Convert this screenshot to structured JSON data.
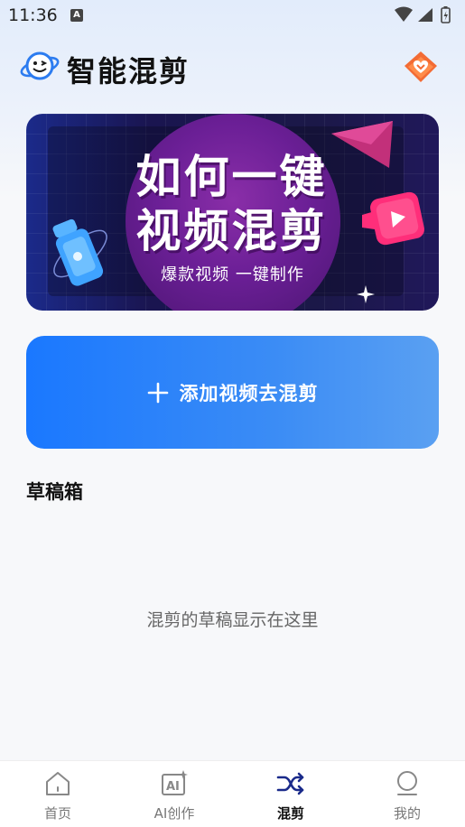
{
  "status_bar": {
    "time": "11:36",
    "notification_icon": "A"
  },
  "header": {
    "title": "智能混剪",
    "logo_icon": "planet-face-icon",
    "vip_icon": "vip-heart-badge-icon"
  },
  "banner": {
    "line1": "如何一键",
    "line2": "视频混剪",
    "subtitle": "爆款视频 一键制作"
  },
  "add_button": {
    "label": "添加视频去混剪",
    "icon": "plus-icon"
  },
  "drafts": {
    "title": "草稿箱",
    "empty_text": "混剪的草稿显示在这里"
  },
  "bottom_nav": {
    "items": [
      {
        "label": "首页",
        "icon": "home-icon",
        "active": false
      },
      {
        "label": "AI创作",
        "icon": "ai-create-icon",
        "active": false
      },
      {
        "label": "混剪",
        "icon": "shuffle-icon",
        "active": true
      },
      {
        "label": "我的",
        "icon": "profile-icon",
        "active": false
      }
    ]
  },
  "colors": {
    "accent": "#1a78ff",
    "active_nav": "#1a2a8a"
  }
}
